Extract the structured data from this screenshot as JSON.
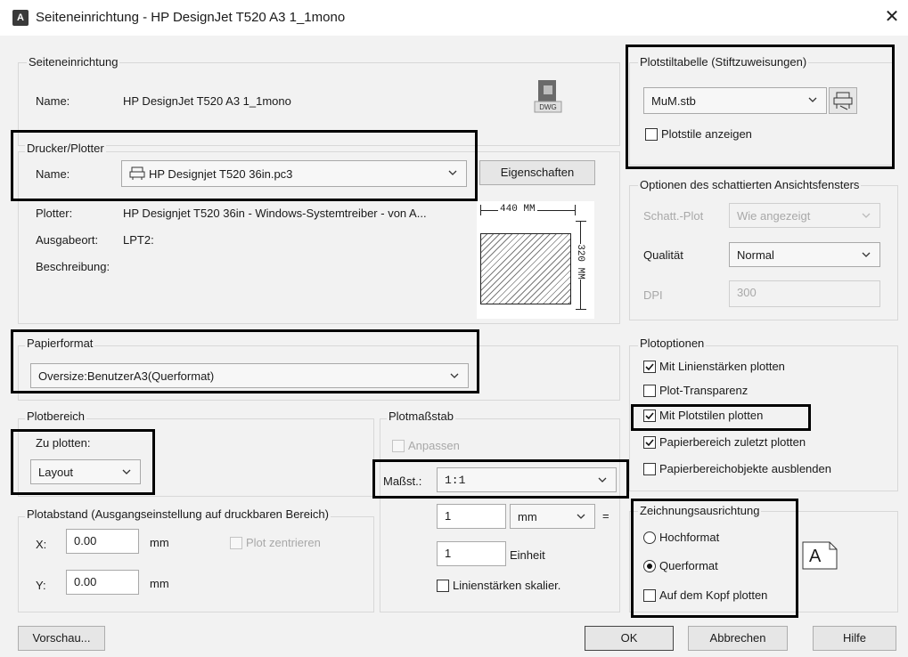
{
  "window": {
    "title": "Seiteneinrichtung - HP DesignJet T520 A3 1_1mono",
    "close_glyph": "✕",
    "app_icon_glyph": "A"
  },
  "page_setup": {
    "group_label": "Seiteneinrichtung",
    "name_label": "Name:",
    "name_value": "HP DesignJet T520 A3 1_1mono",
    "dwg_label": "DWG"
  },
  "printer": {
    "group_label": "Drucker/Plotter",
    "name_label": "Name:",
    "name_value": "HP Designjet T520 36in.pc3",
    "properties_button": "Eigenschaften",
    "plotter_label": "Plotter:",
    "plotter_value": "HP Designjet T520 36in - Windows-Systemtreiber - von A...",
    "output_label": "Ausgabeort:",
    "output_value": "LPT2:",
    "description_label": "Beschreibung:",
    "preview_width_label": "440 MM",
    "preview_height_label": "320 MM"
  },
  "paper": {
    "group_label": "Papierformat",
    "value": "Oversize:BenutzerA3(Querformat)"
  },
  "plot_area": {
    "group_label": "Plotbereich",
    "what_label": "Zu plotten:",
    "what_value": "Layout"
  },
  "plot_offset": {
    "group_label": "Plotabstand (Ausgangseinstellung auf druckbaren Bereich)",
    "x_label": "X:",
    "x_value": "0.00",
    "x_unit": "mm",
    "y_label": "Y:",
    "y_value": "0.00",
    "y_unit": "mm",
    "center_label": "Plot zentrieren"
  },
  "scale": {
    "group_label": "Plotmaßstab",
    "fit_label": "Anpassen",
    "scale_label": "Maßst.:",
    "scale_value": "1:1",
    "value1": "1",
    "unit_value": "mm",
    "equals": "=",
    "value2": "1",
    "unit2_label": "Einheit",
    "lineweights_label": "Linienstärken skalier."
  },
  "plot_style_table": {
    "group_label": "Plotstiltabelle (Stiftzuweisungen)",
    "value": "MuM.stb",
    "show_label": "Plotstile anzeigen"
  },
  "shaded": {
    "group_label": "Optionen des schattierten Ansichtsfensters",
    "shade_label": "Schatt.-Plot",
    "shade_value": "Wie angezeigt",
    "quality_label": "Qualität",
    "quality_value": "Normal",
    "dpi_label": "DPI",
    "dpi_value": "300"
  },
  "plot_options": {
    "group_label": "Plotoptionen",
    "items": [
      {
        "label": "Mit Linienstärken plotten",
        "checked": true
      },
      {
        "label": "Plot-Transparenz",
        "checked": false
      },
      {
        "label": "Mit Plotstilen plotten",
        "checked": true
      },
      {
        "label": "Papierbereich zuletzt plotten",
        "checked": true
      },
      {
        "label": "Papierbereichobjekte ausblenden",
        "checked": false
      }
    ]
  },
  "orientation": {
    "group_label": "Zeichnungsausrichtung",
    "portrait_label": "Hochformat",
    "landscape_label": "Querformat",
    "upside_label": "Auf dem Kopf plotten",
    "icon_glyph": "A"
  },
  "buttons": {
    "preview": "Vorschau...",
    "ok": "OK",
    "cancel": "Abbrechen",
    "help": "Hilfe"
  },
  "colors": {
    "background": "#f2f2f2",
    "highlight": "#000000"
  }
}
